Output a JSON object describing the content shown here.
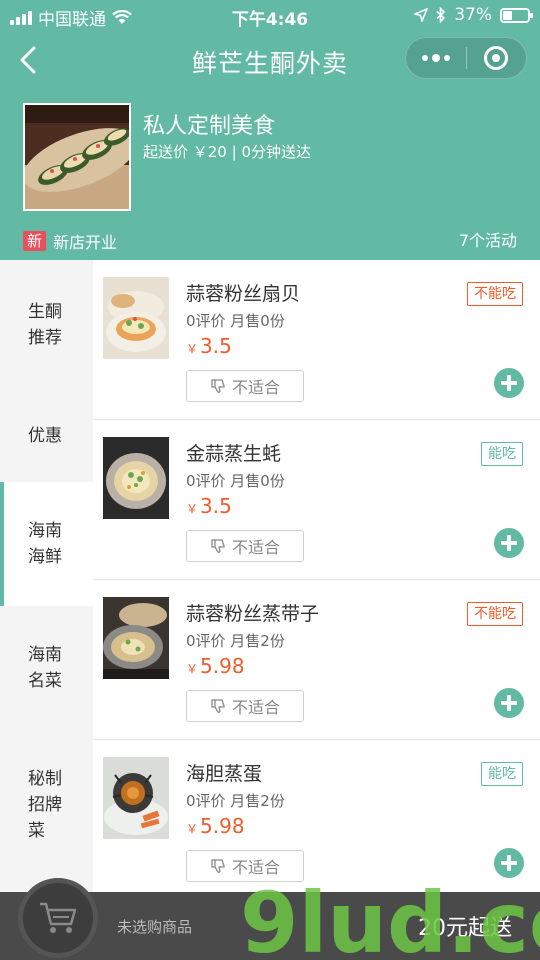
{
  "status_bar": {
    "carrier": "中国联通",
    "time": "下午4:46",
    "battery_percent": "37%",
    "battery_level": 0.37
  },
  "nav": {
    "title": "鲜芒生酮外卖"
  },
  "shop": {
    "name": "私人定制美食",
    "meta": "起送价 ￥20 | 0分钟送达",
    "promo_badge": "新",
    "promo_text": "新店开业",
    "activity_count": "7个活动"
  },
  "sidebar": {
    "items": [
      {
        "label": "生酮\n推荐"
      },
      {
        "label": "优惠"
      },
      {
        "label": "海南\n海鲜",
        "active": true
      },
      {
        "label": "海南\n名菜"
      },
      {
        "label": "秘制\n招牌\n菜"
      }
    ]
  },
  "products": [
    {
      "name": "蒜蓉粉丝扇贝",
      "stats": "0评价  月售0份",
      "currency": "￥",
      "price": "3.5",
      "tag": "不能吃",
      "tag_type": "no",
      "dislike": "不适合"
    },
    {
      "name": "金蒜蒸生蚝",
      "stats": "0评价  月售0份",
      "currency": "￥",
      "price": "3.5",
      "tag": "能吃",
      "tag_type": "yes",
      "dislike": "不适合"
    },
    {
      "name": "蒜蓉粉丝蒸带子",
      "stats": "0评价  月售2份",
      "currency": "￥",
      "price": "5.98",
      "tag": "不能吃",
      "tag_type": "no",
      "dislike": "不适合"
    },
    {
      "name": "海胆蒸蛋",
      "stats": "0评价  月售2份",
      "currency": "￥",
      "price": "5.98",
      "tag": "能吃",
      "tag_type": "yes",
      "dislike": "不适合"
    }
  ],
  "cart": {
    "status": "未选购商品",
    "min_order": "20元起送"
  },
  "watermark": {
    "text": "9lud.com"
  },
  "colors": {
    "accent": "#62b9a4",
    "price": "#f05d2a",
    "cart_bar": "#4a4a4a"
  }
}
